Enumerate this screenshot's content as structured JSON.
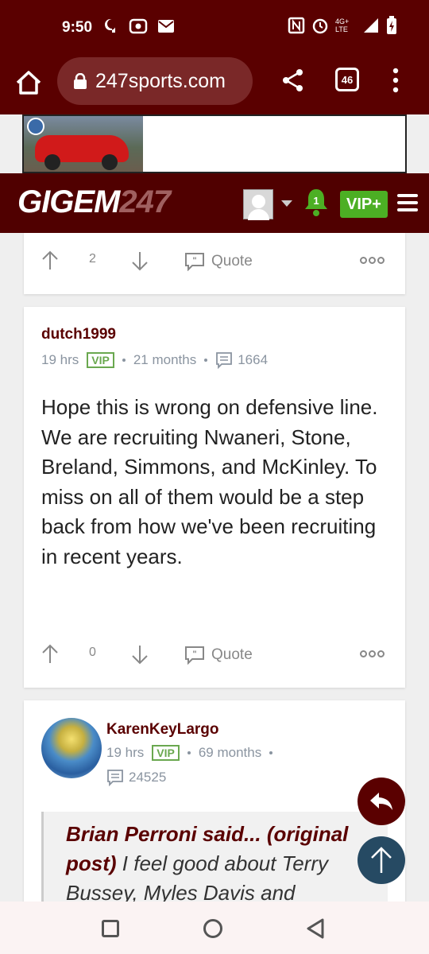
{
  "status": {
    "time": "9:50",
    "network": "4G+ LTE"
  },
  "browser": {
    "url": "247sports.com",
    "tab_count": "46"
  },
  "site": {
    "logo_main": "GIGEM",
    "logo_num": "247",
    "notification_count": "1",
    "vip_label": "VIP+"
  },
  "posts": [
    {
      "upvotes": "2",
      "quote_label": "Quote"
    },
    {
      "username": "dutch1999",
      "time": "19 hrs",
      "badge": "VIP",
      "tenure": "21 months",
      "post_count": "1664",
      "body": "Hope this is wrong on defensive line. We are recruiting Nwaneri, Stone, Breland, Simmons, and McKinley. To miss on all of them would be a step back from how we've been recruiting in recent years.",
      "upvotes": "0",
      "quote_label": "Quote"
    },
    {
      "username": "KarenKeyLargo",
      "time": "19 hrs",
      "badge": "VIP",
      "tenure": "69 months",
      "post_count": "24525",
      "quote_author": "Brian Perroni said... (original post)",
      "quote_text": " I feel good about Terry Bussey, Myles Davis and"
    }
  ],
  "colors": {
    "maroon": "#500000",
    "vip_green": "#4caf24",
    "scroll_top_blue": "#264a63"
  }
}
